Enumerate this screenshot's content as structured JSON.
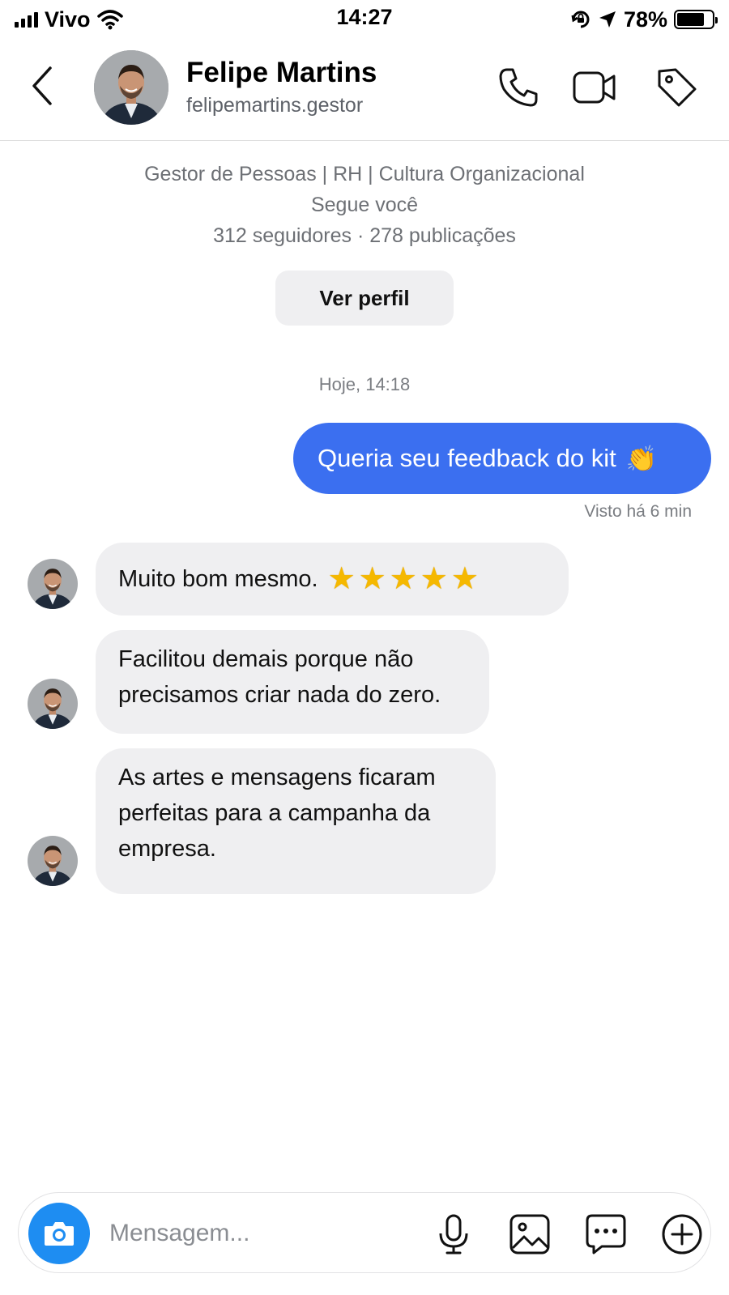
{
  "status_bar": {
    "carrier": "Vivo",
    "time": "14:27",
    "battery": "78%",
    "battery_level": 0.78
  },
  "header": {
    "name": "Felipe Martins",
    "handle": "felipemartins.gestor"
  },
  "profile": {
    "bio": "Gestor de Pessoas | RH | Cultura Organizacional",
    "follows_you": "Segue você",
    "stats": "312 seguidores · 278 publicações",
    "view_profile_label": "Ver perfil"
  },
  "conversation": {
    "timestamp": "Hoje, 14:18",
    "sent": [
      {
        "text": "Queria seu feedback do kit",
        "emoji": "👏"
      }
    ],
    "seen": "Visto há 6 min",
    "received": [
      {
        "text": "Muito bom mesmo.",
        "stars": "★★★★★",
        "rating": 5
      },
      {
        "text": "Facilitou demais porque não precisamos criar nada do zero."
      },
      {
        "text": "As artes e mensagens ficaram perfeitas para a campanha da empresa."
      }
    ]
  },
  "composer": {
    "placeholder": "Mensagem..."
  },
  "colors": {
    "sent_bubble": "#3b6ff0",
    "received_bubble": "#efeff1",
    "camera_button": "#1e8df2"
  }
}
